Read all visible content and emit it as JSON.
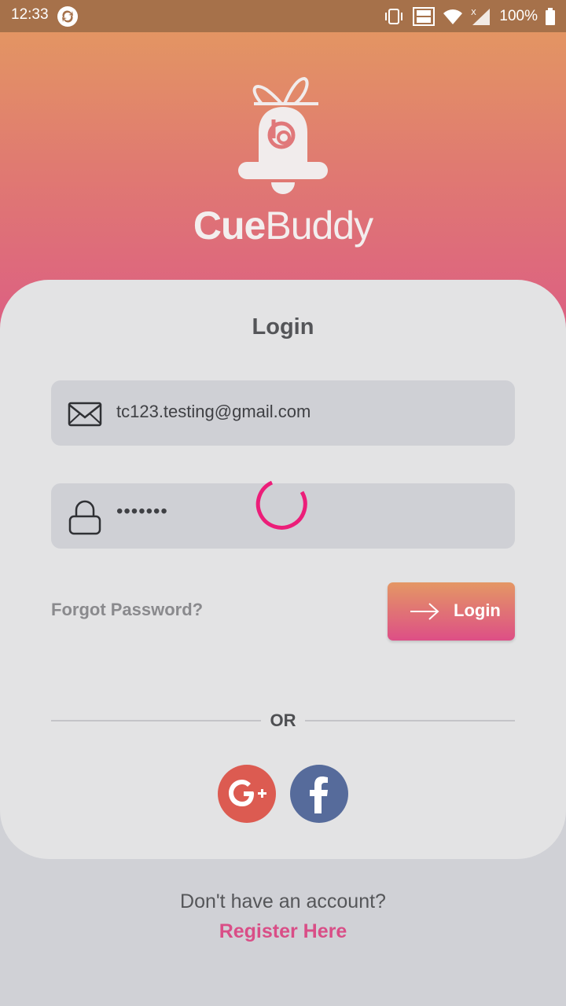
{
  "status_bar": {
    "time": "12:33",
    "battery_text": "100%",
    "icons": [
      "app-sync-icon",
      "vibrate-icon",
      "vowifi-icon",
      "wifi-icon",
      "signal-icon",
      "battery-icon"
    ]
  },
  "brand": {
    "name_bold": "Cue",
    "name_light": "Buddy",
    "logo_icon": "bell-gift-logo"
  },
  "login_card": {
    "title": "Login",
    "email_value": "tc123.testing@gmail.com",
    "password_value": "•••••••",
    "loading": true,
    "forgot_label": "Forgot Password?",
    "login_button_label": "Login",
    "or_label": "OR"
  },
  "footer": {
    "no_account_text": "Don't have an account?",
    "register_label": "Register Here"
  },
  "colors": {
    "accent_pink": "#d94e87",
    "gradient_top": "#e39563",
    "gradient_bottom": "#dc5f83",
    "spinner": "#ec1e79",
    "google": "#dc5b51",
    "facebook": "#566b9b"
  }
}
